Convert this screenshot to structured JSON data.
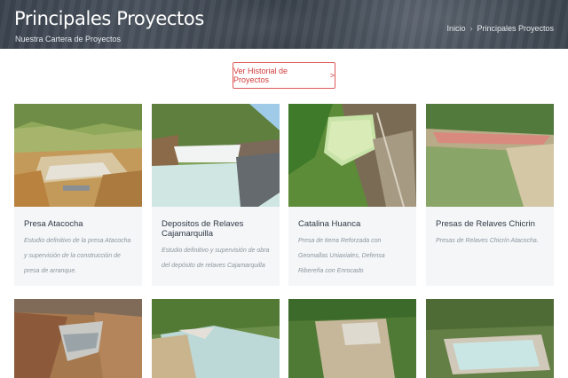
{
  "header": {
    "title": "Principales Proyectos",
    "subtitle": "Nuestra Cartera de Proyectos",
    "breadcrumb": {
      "home": "Inicio",
      "separator": "›",
      "current": "Principales Proyectos"
    }
  },
  "history_button": {
    "label": "Ver Historial de Proyectos",
    "arrow": ">"
  },
  "colors": {
    "accent": "#d23b3b",
    "card_bg": "#f4f6f8",
    "header_bg": "#3b4450"
  },
  "projects": [
    {
      "title": "Presa Atacocha",
      "description": "Estudio definitivo de la presa Atacocha y supervisión de la construcción de presa de arranque."
    },
    {
      "title": "Depositos de Relaves Cajamarquilla",
      "description": "Estudio definitivo y supervisión de obra del depósito de relaves Cajamarquilla"
    },
    {
      "title": "Catalina Huanca",
      "description": "Presa de tierra Reforzada con Geomallas Uniaxiales, Defensa Ribereña con Enrocado"
    },
    {
      "title": "Presas de Relaves Chicrin",
      "description": "Presas de Relaves Chicrín Atacocha."
    }
  ]
}
